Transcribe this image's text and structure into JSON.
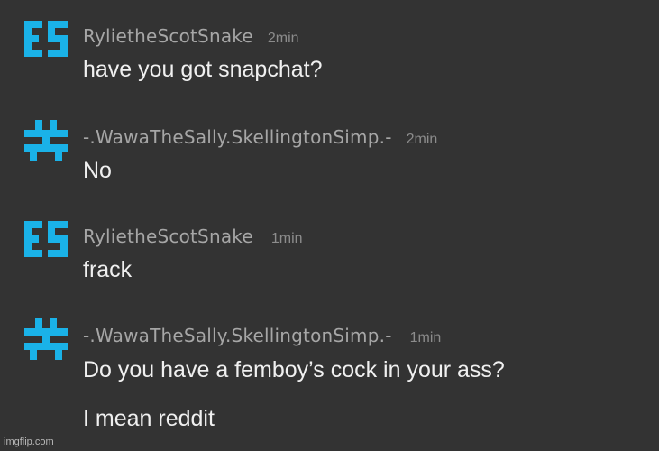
{
  "messages": [
    {
      "username": "RylietheScotSnake",
      "time": "2min",
      "avatar_icon": "rylie-avatar-icon",
      "lines": [
        "have you got snapchat?"
      ]
    },
    {
      "username": "-.WawaTheSally.SkellingtonSimp.-",
      "time": "2min",
      "avatar_icon": "wawa-avatar-icon",
      "lines": [
        "No"
      ]
    },
    {
      "username": "RylietheScotSnake",
      "time": "1min",
      "avatar_icon": "rylie-avatar-icon",
      "lines": [
        "frack"
      ]
    },
    {
      "username": "-.WawaTheSally.SkellingtonSimp.-",
      "time": "1min",
      "avatar_icon": "wawa-avatar-icon",
      "lines": [
        "Do you have a femboy’s cock in your ass?",
        "I mean reddit"
      ]
    }
  ],
  "colors": {
    "background": "#333333",
    "avatar_blue": "#1ab2e8",
    "username": "#a6a6a6",
    "timestamp": "#8c8c8c",
    "message_text": "#f0f0f0"
  },
  "watermark": "imgflip.com"
}
